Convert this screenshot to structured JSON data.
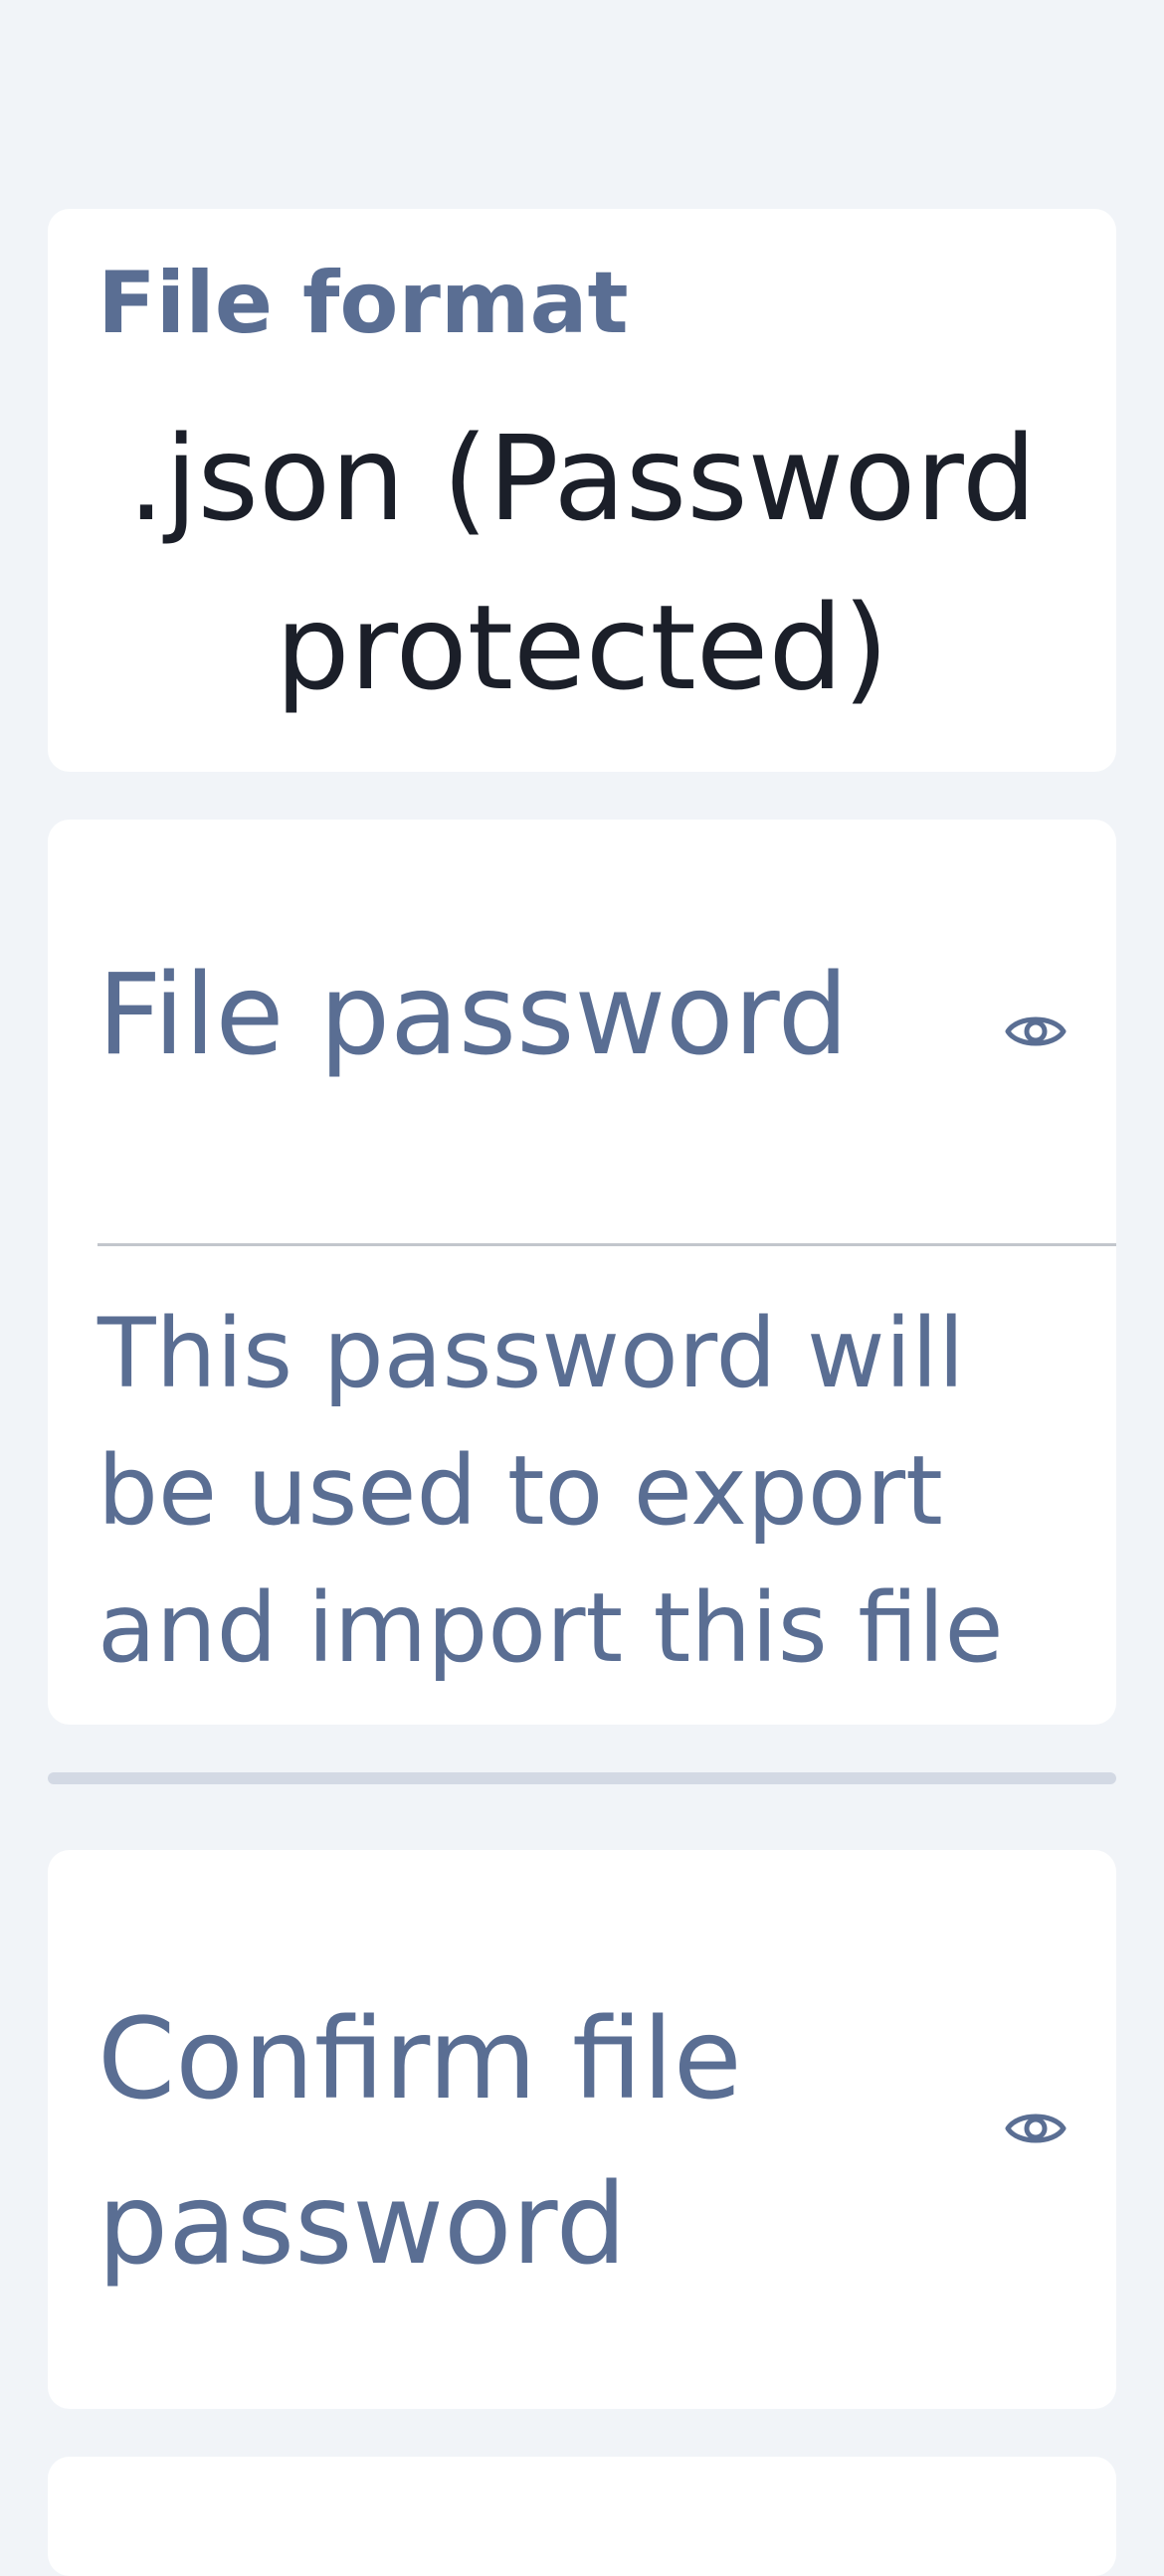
{
  "file_format": {
    "label": "File format",
    "value": ".json (Password protected)"
  },
  "file_password": {
    "label": "File password",
    "toggle_icon": "eye-icon",
    "helper_text": "This password will be used to export and import this file"
  },
  "confirm_password": {
    "label": "Confirm file password",
    "toggle_icon": "eye-icon"
  },
  "colors": {
    "background": "#f1f4f8",
    "card": "#ffffff",
    "label": "#5a6e93",
    "value_text": "#1b1f29",
    "divider": "#d3d9e4"
  }
}
